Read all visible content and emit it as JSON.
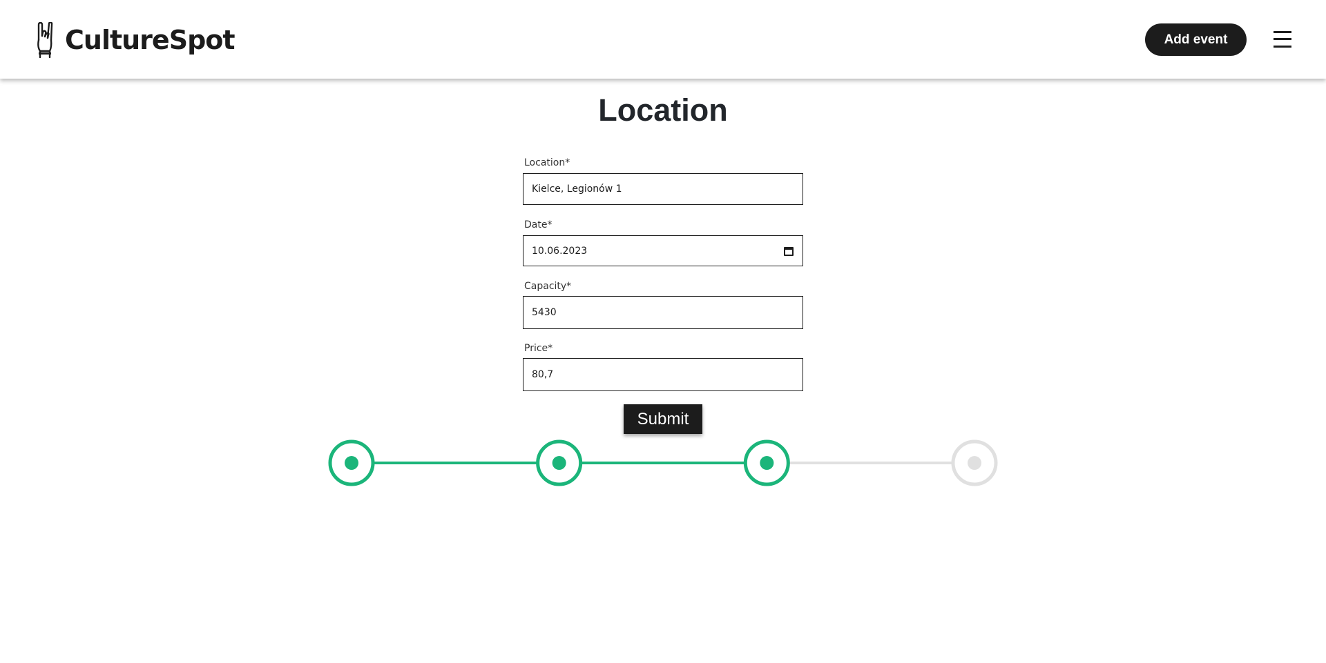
{
  "header": {
    "brand": "CultureSpot",
    "add_event_label": "Add event"
  },
  "main": {
    "title": "Location",
    "fields": [
      {
        "label": "Location*",
        "value": "Kielce, Legionów 1"
      },
      {
        "label": "Date*",
        "value": "10.06.2023"
      },
      {
        "label": "Capacity*",
        "value": "5430"
      },
      {
        "label": "Price*",
        "value": "80,7"
      }
    ],
    "submit_label": "Submit"
  },
  "stepper": {
    "total_steps": 4,
    "completed_steps": 3
  },
  "colors": {
    "accent": "#1bb57a",
    "inactive": "#e0e0e0",
    "dark": "#1c1c1c"
  },
  "icons": [
    "rock-hand-icon",
    "hamburger-menu-icon",
    "calendar-icon"
  ]
}
